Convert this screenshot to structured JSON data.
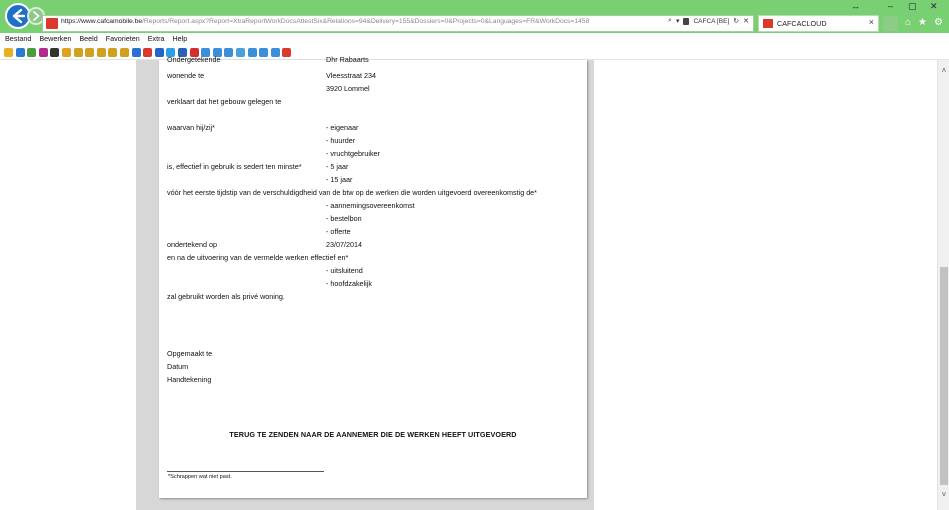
{
  "browser": {
    "url_host": "https://www.cafcamobile.be",
    "url_rest": "/Reports/Report.aspx?Report=XtraReportWorkDocsAttestSix&Relations=94&Delivery=155&Dossiers=0&Projects=0&Languages=FR&WorkDocs=1458",
    "cert_label": "CAFCA [BE]",
    "tab_label": "CAFCACLOUD",
    "tab_close": "×"
  },
  "window_controls": {
    "resize": "↔",
    "minimize": "–",
    "maximize": "▢",
    "close": "✕"
  },
  "menu": [
    "Bestand",
    "Bewerken",
    "Beeld",
    "Favorieten",
    "Extra",
    "Help"
  ],
  "favorites_colors": [
    "#e7b020",
    "#2b7ad1",
    "#4a9d3a",
    "#b42b8e",
    "#333333",
    "#e0a020",
    "#d0a020",
    "#d0a020",
    "#d0a020",
    "#d0a020",
    "#d0a020",
    "#2b6fd0",
    "#d83b2b",
    "#1e66c8",
    "#2ba0e8",
    "#2c5fb8",
    "#d03030",
    "#3a8fd8",
    "#3a8fd8",
    "#3a8fd8",
    "#4aa0d8",
    "#3a8fd8",
    "#3a8fd8",
    "#3a8fd8",
    "#d83b2b"
  ],
  "document": {
    "top_partial": "Ondergetekende",
    "top_partial_value": "Dhr Rabaarts",
    "wonende_label": "wonende te",
    "address_line1": "Vleesstraat 234",
    "address_line2": "3920 Lommel",
    "verklaart": "verklaart dat het gebouw gelegen te",
    "waarvan_label": "waarvan hij/zij*",
    "waarvan_options": [
      "- eigenaar",
      "- huurder",
      "- vruchtgebruiker"
    ],
    "gebruik_label": "is, effectief in gebruik is sedert ten minste*",
    "gebruik_options": [
      "- 5 jaar",
      "- 15 jaar"
    ],
    "voor_het": "vóór het eerste tijdstip van de verschuldigdheid van de btw op de werken die worden uitgevoerd overeenkomstig de*",
    "contract_options": [
      "- aannemingsovereenkomst",
      "- bestelbon",
      "- offerte"
    ],
    "ondertekend_label": "ondertekend op",
    "ondertekend_value": "23/07/2014",
    "en_na": "en na de uitvoering van de vermelde werken effectief en*",
    "usage_options": [
      "- uitsluitend",
      "- hoofdzakelijk"
    ],
    "zal_gebruikt": "zal gebruikt worden als privé woning.",
    "opgemaakt": "Opgemaakt te",
    "datum": "Datum",
    "handtekening": "Handtekening",
    "return_title": "TERUG TE ZENDEN NAAR DE AANNEMER DIE DE WERKEN HEEFT UITGEVOERD",
    "footnote": "*Schrappen wat niet past."
  },
  "scrollbar": {
    "up": "˄",
    "down": "˅"
  }
}
